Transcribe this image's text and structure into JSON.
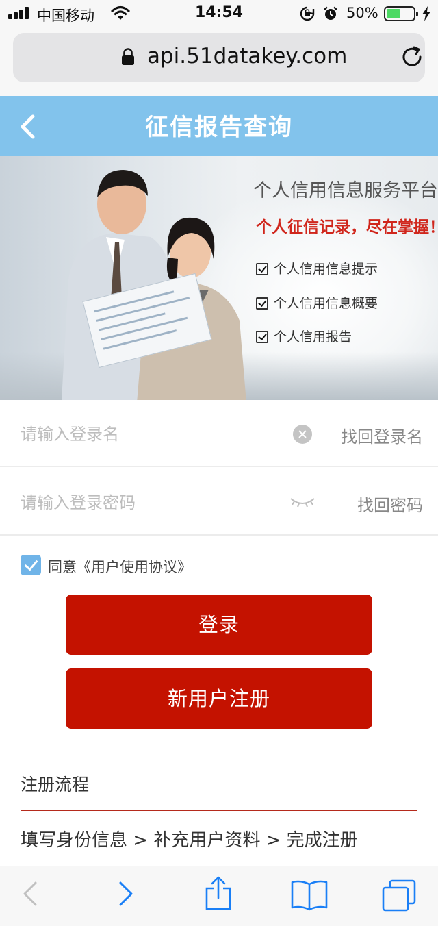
{
  "status_bar": {
    "carrier": "中国移动",
    "time": "14:54",
    "battery_percent": "50%",
    "battery_level": 0.5,
    "icons": [
      "signal-icon",
      "wifi-icon",
      "orientation-lock-icon",
      "alarm-icon",
      "battery-icon",
      "charging-icon"
    ]
  },
  "browser": {
    "url": "api.51datakey.com",
    "icons": [
      "lock-icon",
      "reload-icon"
    ]
  },
  "header": {
    "title": "征信报告查询",
    "back_icon": "chevron-left-icon"
  },
  "banner": {
    "title": "个人信用信息服务平台",
    "slogan": "个人征信记录，尽在掌握！",
    "items": [
      "个人信用信息提示",
      "个人信用信息概要",
      "个人信用报告"
    ]
  },
  "form": {
    "username_placeholder": "请输入登录名",
    "username_value": "",
    "find_username": "找回登录名",
    "password_placeholder": "请输入登录密码",
    "password_value": "",
    "find_password": "找回密码",
    "agree_label": "同意《用户使用协议》",
    "agree_checked": true,
    "login_button": "登录",
    "register_button": "新用户注册"
  },
  "registration": {
    "title": "注册流程",
    "steps": "填写身份信息 > 补充用户资料 > 完成注册"
  },
  "toolbar": {
    "icons": [
      "back-arrow-icon",
      "forward-arrow-icon",
      "share-icon",
      "bookmarks-icon",
      "tabs-icon"
    ]
  },
  "colors": {
    "header_bg": "#82c3ec",
    "button_red": "#c41200",
    "checkbox_blue": "#70b4e8",
    "slogan_red": "#d0261c",
    "toolbar_blue": "#1a7ff6"
  }
}
